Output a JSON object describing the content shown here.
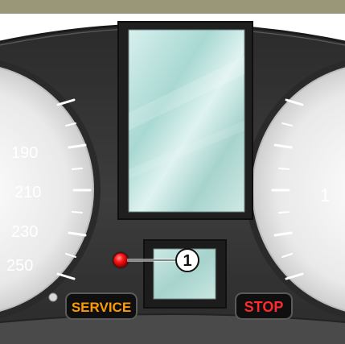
{
  "cluster": {
    "left_gauge_ticks": [
      "190",
      "210",
      "230",
      "250"
    ],
    "right_gauge_tick": "1",
    "callout_number": "1",
    "service_label": "SERVICE",
    "stop_label": "STOP"
  },
  "colors": {
    "top_bar": "#9a9779",
    "panel": "#3a3a3a",
    "display_glass": "#bfe6e0",
    "warning_light": "#ff1a1a",
    "service_text": "#ff9a00",
    "stop_text": "#ff2a2a"
  }
}
